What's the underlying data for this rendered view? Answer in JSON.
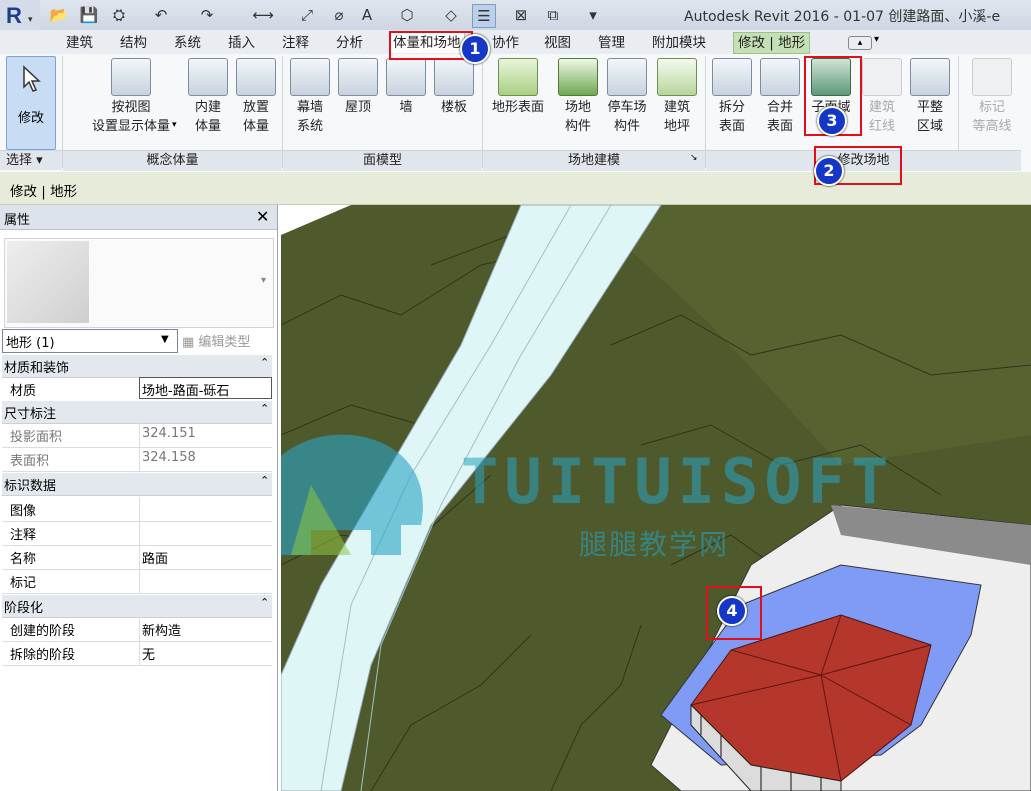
{
  "window": {
    "title": "Autodesk Revit 2016 -    01-07 创建路面、小溪-e"
  },
  "tabs": [
    {
      "label": "建筑"
    },
    {
      "label": "结构"
    },
    {
      "label": "系统"
    },
    {
      "label": "插入"
    },
    {
      "label": "注释"
    },
    {
      "label": "分析"
    },
    {
      "label": "体量和场地"
    },
    {
      "label": "协作"
    },
    {
      "label": "视图"
    },
    {
      "label": "管理"
    },
    {
      "label": "附加模块"
    },
    {
      "label": "修改 | 地形"
    }
  ],
  "ribbon": {
    "modify": {
      "label": "修改"
    },
    "select": {
      "label": "选择 ▾"
    },
    "conceptual_mass": {
      "panel_label": "概念体量",
      "show_mass_1": "按视图",
      "show_mass_2": "设置显示体量",
      "inplace_1": "内建",
      "inplace_2": "体量",
      "place_1": "放置",
      "place_2": "体量"
    },
    "face_model": {
      "panel_label": "面模型",
      "curtain_1": "幕墙",
      "curtain_2": "系统",
      "roof": "屋顶",
      "wall": "墙",
      "floor": "楼板"
    },
    "site_modeling": {
      "panel_label": "场地建模",
      "toposurface": "地形表面",
      "site_comp_1": "场地",
      "site_comp_2": "构件",
      "parking_1": "停车场",
      "parking_2": "构件",
      "pad_1": "建筑",
      "pad_2": "地坪"
    },
    "modify_site": {
      "panel_label": "修改场地",
      "split_1": "拆分",
      "split_2": "表面",
      "merge_1": "合并",
      "merge_2": "表面",
      "subregion": "子面域",
      "property_line_1": "建筑",
      "property_line_2": "红线",
      "graded_1": "平整",
      "graded_2": "区域",
      "label_contours_1": "标记",
      "label_contours_2": "等高线"
    }
  },
  "options_bar": {
    "label": "修改 | 地形"
  },
  "properties": {
    "title": "属性",
    "close": "✕",
    "type_selector": "地形 (1)",
    "edit_type": "编辑类型",
    "sections": {
      "materials": "材质和装饰",
      "dimensions": "尺寸标注",
      "identity": "标识数据",
      "phasing": "阶段化"
    },
    "rows": {
      "material": {
        "k": "材质",
        "v": "场地-路面-砾石"
      },
      "projected_area": {
        "k": "投影面积",
        "v": "324.151"
      },
      "surface_area": {
        "k": "表面积",
        "v": "324.158"
      },
      "image": {
        "k": "图像",
        "v": ""
      },
      "comments": {
        "k": "注释",
        "v": ""
      },
      "name": {
        "k": "名称",
        "v": "路面"
      },
      "mark": {
        "k": "标记",
        "v": ""
      },
      "phase_created": {
        "k": "创建的阶段",
        "v": "新构造"
      },
      "phase_demolished": {
        "k": "拆除的阶段",
        "v": "无"
      }
    }
  },
  "watermark": {
    "brand": "TUITUISOFT",
    "subtitle": "腿腿教学网"
  },
  "badges": {
    "b1": "1",
    "b2": "2",
    "b3": "3",
    "b4": "4"
  },
  "colors": {
    "terrain": "#4e5a2c",
    "road": "#dff6f6",
    "roof": "#b5362b",
    "water": "#7f9bf5"
  }
}
